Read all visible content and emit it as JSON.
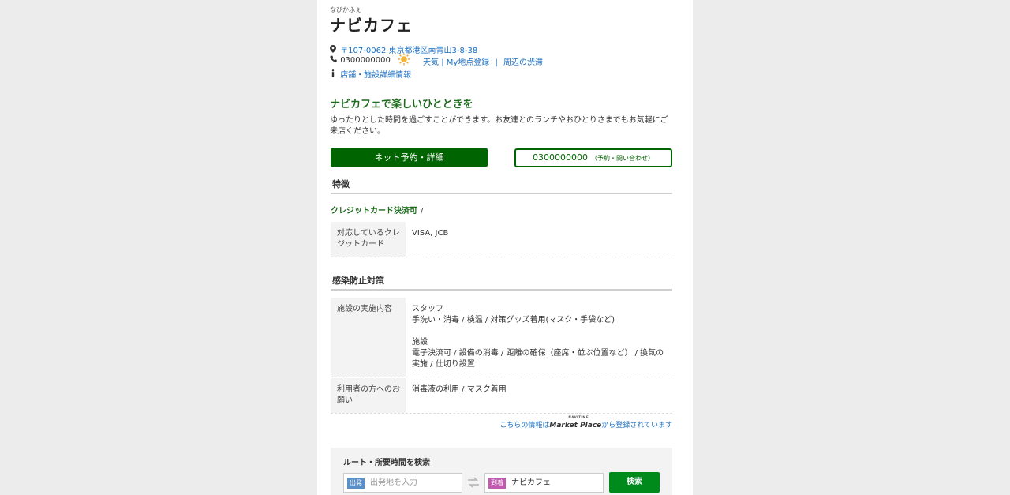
{
  "shop": {
    "ruby": "なびかふぇ",
    "name": "ナビカフェ",
    "address": "〒107-0062 東京都港区南青山3-8-38",
    "phone": "0300000000",
    "weather_link": "天気",
    "my_spot_link": "My地点登録",
    "sep": "|",
    "traffic_link": "周辺の渋滞",
    "detail_link": "店舗・施設詳細情報"
  },
  "catch": {
    "title": "ナビカフェで楽しいひとときを",
    "description": "ゆったりとした時間を過ごすことができます。お友達とのランチやおひとりさまでもお気軽にご来店ください。"
  },
  "buttons": {
    "reserve": "ネット予約・詳細",
    "tel_number": "0300000000",
    "tel_note": "（予約・問い合わせ）"
  },
  "features": {
    "title": "特徴",
    "tag": "クレジットカード決済可",
    "tag_sep": "/",
    "rows": [
      {
        "label": "対応しているクレジットカード",
        "value": "VISA, JCB"
      }
    ]
  },
  "infection": {
    "title": "感染防止対策",
    "rows": [
      {
        "label": "施設の実施内容",
        "staff_head": "スタッフ",
        "staff_items": "手洗い・消毒 / 検温 / 対策グッズ着用(マスク・手袋など)",
        "facility_head": "施設",
        "facility_items": "電子決済可 / 設備の消毒 / 距離の確保（座席・並ぶ位置など） / 換気の実施 / 仕切り設置"
      },
      {
        "label": "利用者の方へのお願い",
        "value": "消毒液の利用 / マスク着用"
      }
    ]
  },
  "market_place": {
    "prefix": "こちらの情報は",
    "brand": "Market Place",
    "brand_top": "NAVITIME",
    "suffix": "から登録されています"
  },
  "route": {
    "title": "ルート・所要時間を検索",
    "from_tag": "出発",
    "from_placeholder": "出発地を入力",
    "to_tag": "到着",
    "to_value": "ナビカフェ",
    "search_button": "検索"
  },
  "colors": {
    "accent_green": "#006400",
    "link_blue": "#1a6fc2",
    "from_tag": "#5a8fc7",
    "to_tag": "#c25bb0"
  }
}
